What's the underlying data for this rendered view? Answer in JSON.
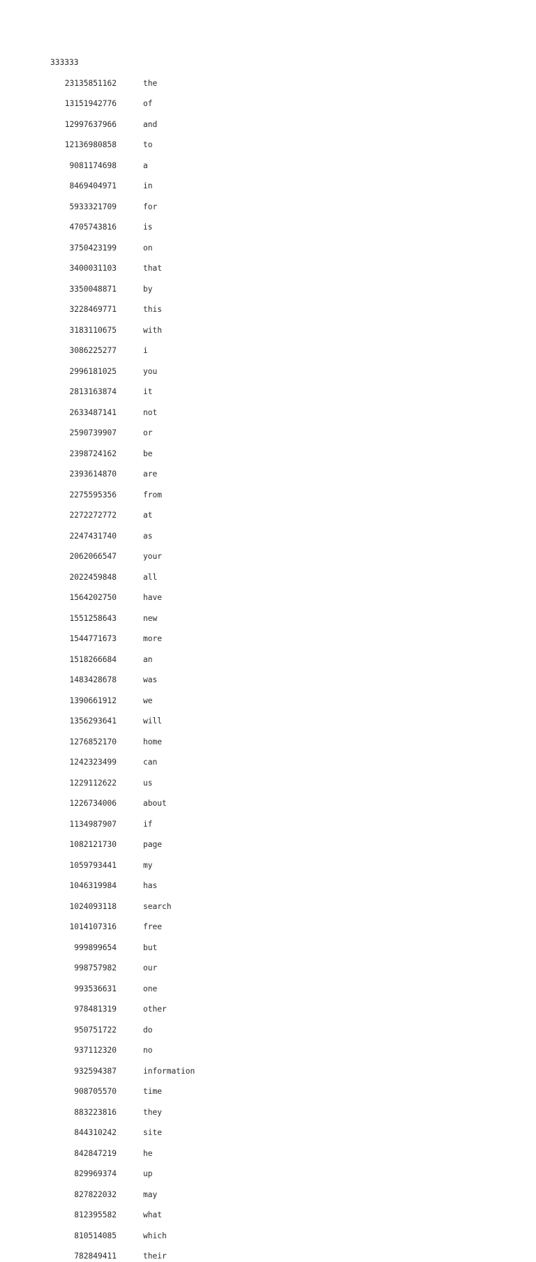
{
  "document": {
    "header": "333333",
    "columns": {
      "count_header": "",
      "word_header": ""
    },
    "rows": [
      {
        "count": "23135851162",
        "word": "the"
      },
      {
        "count": "13151942776",
        "word": "of"
      },
      {
        "count": "12997637966",
        "word": "and"
      },
      {
        "count": "12136980858",
        "word": "to"
      },
      {
        "count": "9081174698",
        "word": "a"
      },
      {
        "count": "8469404971",
        "word": "in"
      },
      {
        "count": "5933321709",
        "word": "for"
      },
      {
        "count": "4705743816",
        "word": "is"
      },
      {
        "count": "3750423199",
        "word": "on"
      },
      {
        "count": "3400031103",
        "word": "that"
      },
      {
        "count": "3350048871",
        "word": "by"
      },
      {
        "count": "3228469771",
        "word": "this"
      },
      {
        "count": "3183110675",
        "word": "with"
      },
      {
        "count": "3086225277",
        "word": "i"
      },
      {
        "count": "2996181025",
        "word": "you"
      },
      {
        "count": "2813163874",
        "word": "it"
      },
      {
        "count": "2633487141",
        "word": "not"
      },
      {
        "count": "2590739907",
        "word": "or"
      },
      {
        "count": "2398724162",
        "word": "be"
      },
      {
        "count": "2393614870",
        "word": "are"
      },
      {
        "count": "2275595356",
        "word": "from"
      },
      {
        "count": "2272272772",
        "word": "at"
      },
      {
        "count": "2247431740",
        "word": "as"
      },
      {
        "count": "2062066547",
        "word": "your"
      },
      {
        "count": "2022459848",
        "word": "all"
      },
      {
        "count": "1564202750",
        "word": "have"
      },
      {
        "count": "1551258643",
        "word": "new"
      },
      {
        "count": "1544771673",
        "word": "more"
      },
      {
        "count": "1518266684",
        "word": "an"
      },
      {
        "count": "1483428678",
        "word": "was"
      },
      {
        "count": "1390661912",
        "word": "we"
      },
      {
        "count": "1356293641",
        "word": "will"
      },
      {
        "count": "1276852170",
        "word": "home"
      },
      {
        "count": "1242323499",
        "word": "can"
      },
      {
        "count": "1229112622",
        "word": "us"
      },
      {
        "count": "1226734006",
        "word": "about"
      },
      {
        "count": "1134987907",
        "word": "if"
      },
      {
        "count": "1082121730",
        "word": "page"
      },
      {
        "count": "1059793441",
        "word": "my"
      },
      {
        "count": "1046319984",
        "word": "has"
      },
      {
        "count": "1024093118",
        "word": "search"
      },
      {
        "count": "1014107316",
        "word": "free"
      },
      {
        "count": "999899654",
        "word": "but"
      },
      {
        "count": "998757982",
        "word": "our"
      },
      {
        "count": "993536631",
        "word": "one"
      },
      {
        "count": "978481319",
        "word": "other"
      },
      {
        "count": "950751722",
        "word": "do"
      },
      {
        "count": "937112320",
        "word": "no"
      },
      {
        "count": "932594387",
        "word": "information"
      },
      {
        "count": "908705570",
        "word": "time"
      },
      {
        "count": "883223816",
        "word": "they"
      },
      {
        "count": "844310242",
        "word": "site"
      },
      {
        "count": "842847219",
        "word": "he"
      },
      {
        "count": "829969374",
        "word": "up"
      },
      {
        "count": "827822032",
        "word": "may"
      },
      {
        "count": "812395582",
        "word": "what"
      },
      {
        "count": "810514085",
        "word": "which"
      },
      {
        "count": "782849411",
        "word": "their"
      }
    ]
  }
}
